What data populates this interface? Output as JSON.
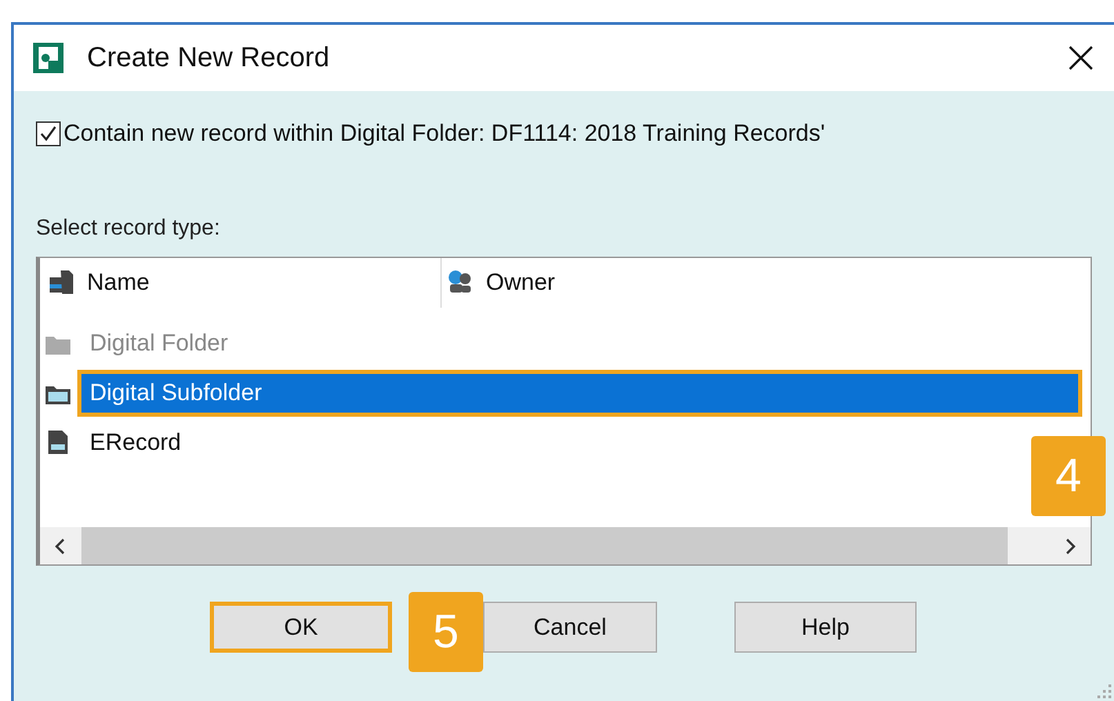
{
  "window": {
    "title": "Create New Record"
  },
  "contain_option": {
    "label": "Contain new record within Digital Folder: DF1114: 2018 Training Records'",
    "checked": true
  },
  "record_type_label": "Select record type:",
  "list": {
    "columns": [
      {
        "label": "Name",
        "kind": "name"
      },
      {
        "label": "Owner",
        "kind": "owner"
      }
    ],
    "rows": [
      {
        "name": "Digital Folder",
        "kind": "folder",
        "disabled": true,
        "selected": false,
        "highlighted": false
      },
      {
        "name": "Digital Subfolder",
        "kind": "subfolder",
        "disabled": false,
        "selected": true,
        "highlighted": true
      },
      {
        "name": "ERecord",
        "kind": "erecord",
        "disabled": false,
        "selected": false,
        "highlighted": false
      }
    ]
  },
  "callouts": [
    {
      "text": "4",
      "kind": "list"
    },
    {
      "text": "5",
      "kind": "buttons"
    }
  ],
  "buttons": [
    {
      "label": "OK",
      "highlighted": true
    },
    {
      "label": "Cancel",
      "highlighted": false
    },
    {
      "label": "Help",
      "highlighted": false
    }
  ]
}
